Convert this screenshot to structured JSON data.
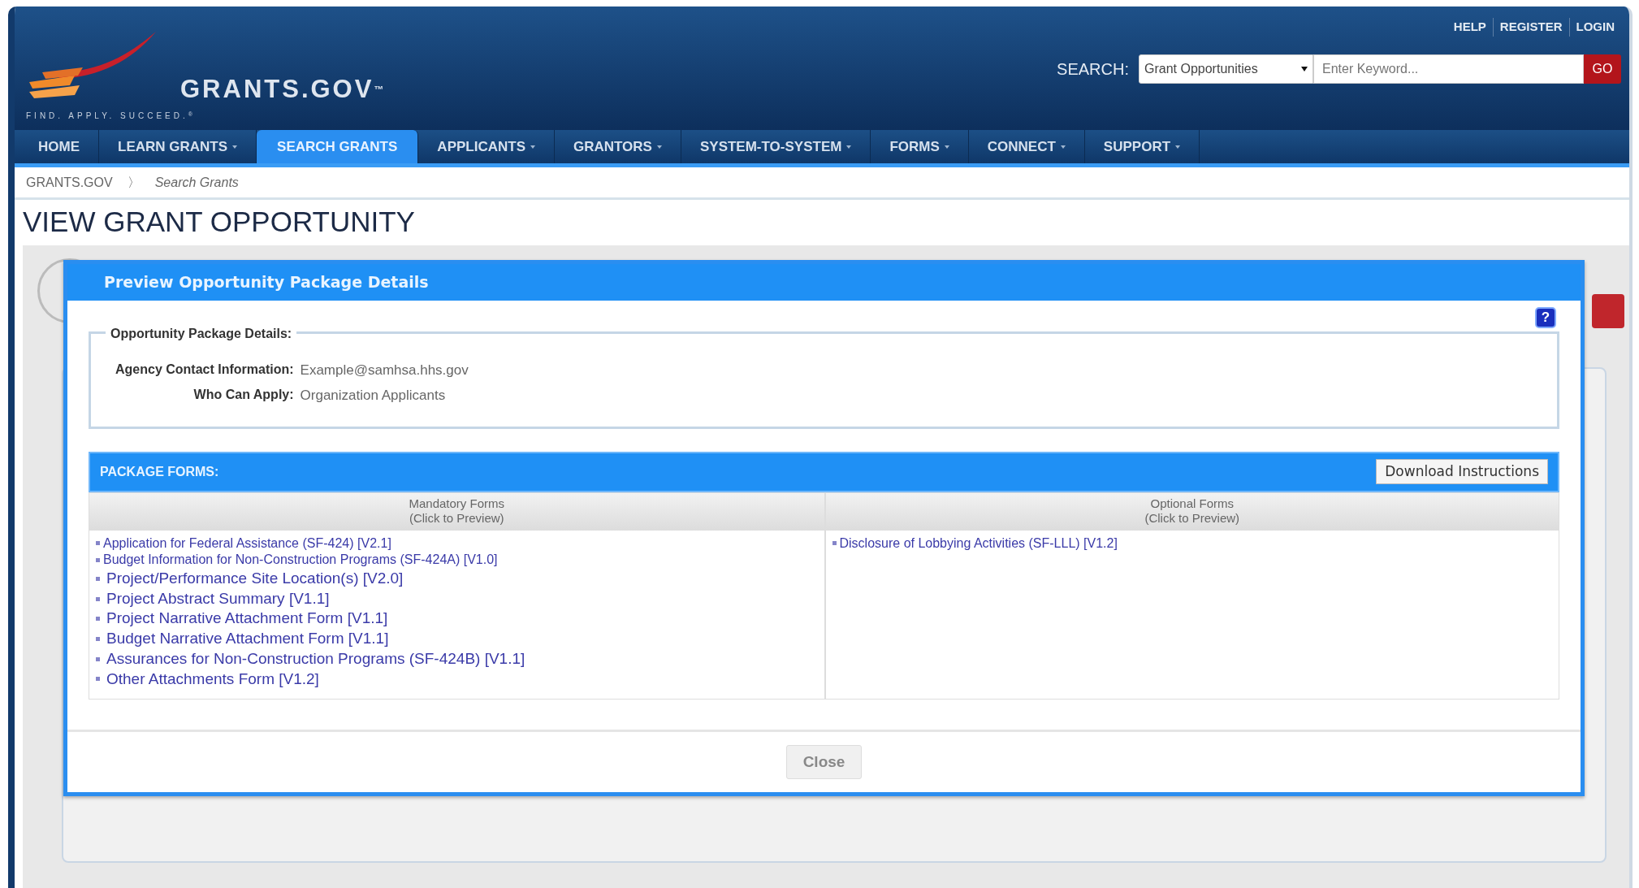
{
  "header": {
    "logo": "GRANTS.GOV$^{™}$",
    "tagline": "FIND. APPLY. SUCCEED.$^{®}$",
    "top_links": [
      "HELP",
      "REGISTER",
      "LOGIN"
    ],
    "search": {
      "label": "SEARCH:",
      "category": "Grant Opportunities",
      "placeholder": "Enter Keyword...",
      "button": "GO"
    }
  },
  "nav": [
    {
      "label": "HOME",
      "has_menu": false,
      "selected": false
    },
    {
      "label": "LEARN GRANTS",
      "has_menu": true,
      "selected": false
    },
    {
      "label": "SEARCH GRANTS",
      "has_menu": false,
      "selected": true
    },
    {
      "label": "APPLICANTS",
      "has_menu": true,
      "selected": false
    },
    {
      "label": "GRANTORS",
      "has_menu": true,
      "selected": false
    },
    {
      "label": "SYSTEM-TO-SYSTEM",
      "has_menu": true,
      "selected": false
    },
    {
      "label": "FORMS",
      "has_menu": true,
      "selected": false
    },
    {
      "label": "CONNECT",
      "has_menu": true,
      "selected": false
    },
    {
      "label": "SUPPORT",
      "has_menu": true,
      "selected": false
    }
  ],
  "breadcrumb": {
    "items": [
      "GRANTS.GOV",
      "Search Grants"
    ],
    "separator": "〉"
  },
  "page_title": "VIEW GRANT OPPORTUNITY",
  "modal": {
    "title": "Preview Opportunity Package Details",
    "help": "?",
    "details": {
      "legend": "Opportunity Package Details:",
      "fields": [
        {
          "label": "Agency Contact Information:",
          "value": "Example@samhsa.hhs.gov"
        },
        {
          "label": "Who Can Apply:",
          "value": "Organization Applicants"
        }
      ]
    },
    "package_forms": {
      "title": "PACKAGE FORMS:",
      "button": "Download Instructions",
      "columns": [
        {
          "heading": "Mandatory Forms",
          "subheading": "(Click to Preview)",
          "forms": [
            {
              "label": "Application for Federal Assistance (SF-424) [V2.1]",
              "kind": "small"
            },
            {
              "label": "Budget Information for Non-Construction Programs (SF-424A) [V1.0]",
              "kind": "small"
            },
            {
              "label": "Project/Performance Site Location(s) [V2.0]",
              "kind": "large"
            },
            {
              "label": "Project Abstract Summary [V1.1]",
              "kind": "large"
            },
            {
              "label": "Project Narrative Attachment Form [V1.1]",
              "kind": "large"
            },
            {
              "label": "Budget Narrative Attachment Form [V1.1]",
              "kind": "large"
            },
            {
              "label": "Assurances for Non-Construction Programs (SF-424B) [V1.1]",
              "kind": "large"
            },
            {
              "label": "Other Attachments Form [V1.2]",
              "kind": "large"
            }
          ]
        },
        {
          "heading": "Optional Forms",
          "subheading": "(Click to Preview)",
          "forms": [
            {
              "label": "Disclosure of Lobbying Activities (SF-LLL) [V1.2]",
              "kind": "small"
            }
          ]
        }
      ]
    },
    "close": "Close"
  }
}
